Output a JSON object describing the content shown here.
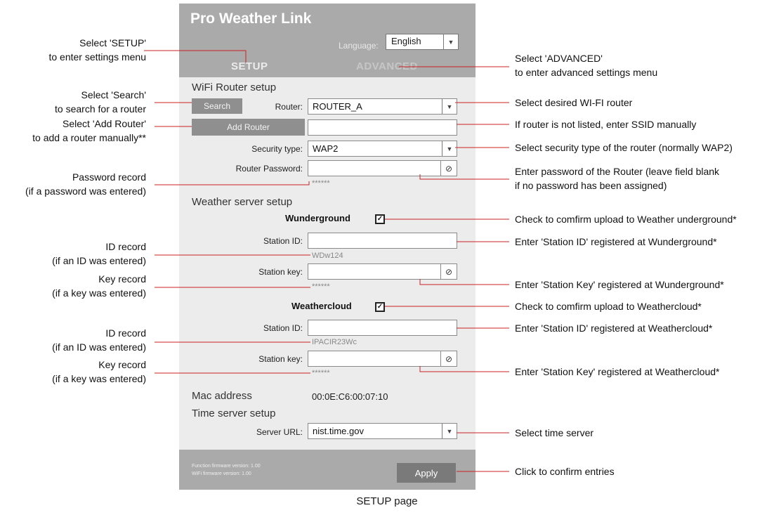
{
  "panel": {
    "title": "Pro Weather Link",
    "language_label": "Language:",
    "language_value": "English",
    "tab_setup": "SETUP",
    "tab_advanced": "ADVANCED",
    "wifi_section": "WiFi Router setup",
    "search_button": "Search",
    "router_label": "Router:",
    "router_value": "ROUTER_A",
    "add_router_button": "Add Router",
    "ssid_value": "",
    "security_label": "Security type:",
    "security_value": "WAP2",
    "password_label": "Router Password:",
    "password_record": "******",
    "weather_section": "Weather server setup",
    "wunderground_title": "Wunderground",
    "wu_station_id_label": "Station ID:",
    "wu_station_id_record": "WDw124",
    "wu_station_key_label": "Station key:",
    "wu_station_key_record": "******",
    "weathercloud_title": "Weathercloud",
    "wc_station_id_label": "Station ID:",
    "wc_station_id_record": "IPACIR23Wc",
    "wc_station_key_label": "Station key:",
    "wc_station_key_record": "******",
    "mac_label": "Mac address",
    "mac_value": "00:0E:C6:00:07:10",
    "time_section": "Time server setup",
    "server_url_label": "Server URL:",
    "server_url_value": "nist.time.gov",
    "function_fw": "Function firmware version: 1.00",
    "wifi_fw": "WiFi firmware version: 1.00",
    "apply_button": "Apply"
  },
  "annotations_left": {
    "setup_1": "Select 'SETUP'",
    "setup_2": "to enter settings menu",
    "search_1": "Select 'Search'",
    "search_2": "to search for a router",
    "add_1": "Select 'Add Router'",
    "add_2": "to add a router manually**",
    "pwd_1": "Password record",
    "pwd_2": "(if a password was entered)",
    "id1_1": "ID record",
    "id1_2": "(if an ID was entered)",
    "key1_1": "Key record",
    "key1_2": "(if a key was entered)",
    "id2_1": "ID record",
    "id2_2": "(if an ID was entered)",
    "key2_1": "Key record",
    "key2_2": "(if a key was entered)"
  },
  "annotations_right": {
    "adv_1": "Select 'ADVANCED'",
    "adv_2": "to enter advanced settings menu",
    "router": "Select desired WI-FI router",
    "ssid": "If router is not listed, enter SSID manually",
    "security": "Select security type of the router (normally WAP2)",
    "pwd_1": "Enter password of the Router (leave field blank",
    "pwd_2": "if no password has been assigned)",
    "wu_check": "Check to comfirm upload to Weather underground*",
    "wu_id": "Enter 'Station ID' registered at Wunderground*",
    "wu_key": "Enter 'Station Key' registered at Wunderground*",
    "wc_check": "Check to comfirm upload to Weathercloud*",
    "wc_id": "Enter 'Station ID' registered at Weathercloud*",
    "wc_key": "Enter 'Station Key' registered at Weathercloud*",
    "time": "Select time server",
    "apply": "Click to confirm entries"
  },
  "caption": "SETUP page",
  "colors": {
    "leader_line": "#cc2222",
    "header_gray": "#aaaaaa",
    "panel_bg": "#ececec"
  },
  "icons": {
    "dropdown": "triangle-down-icon",
    "hide_password": "eye-slash-icon",
    "checkbox": "checkmark-icon"
  }
}
